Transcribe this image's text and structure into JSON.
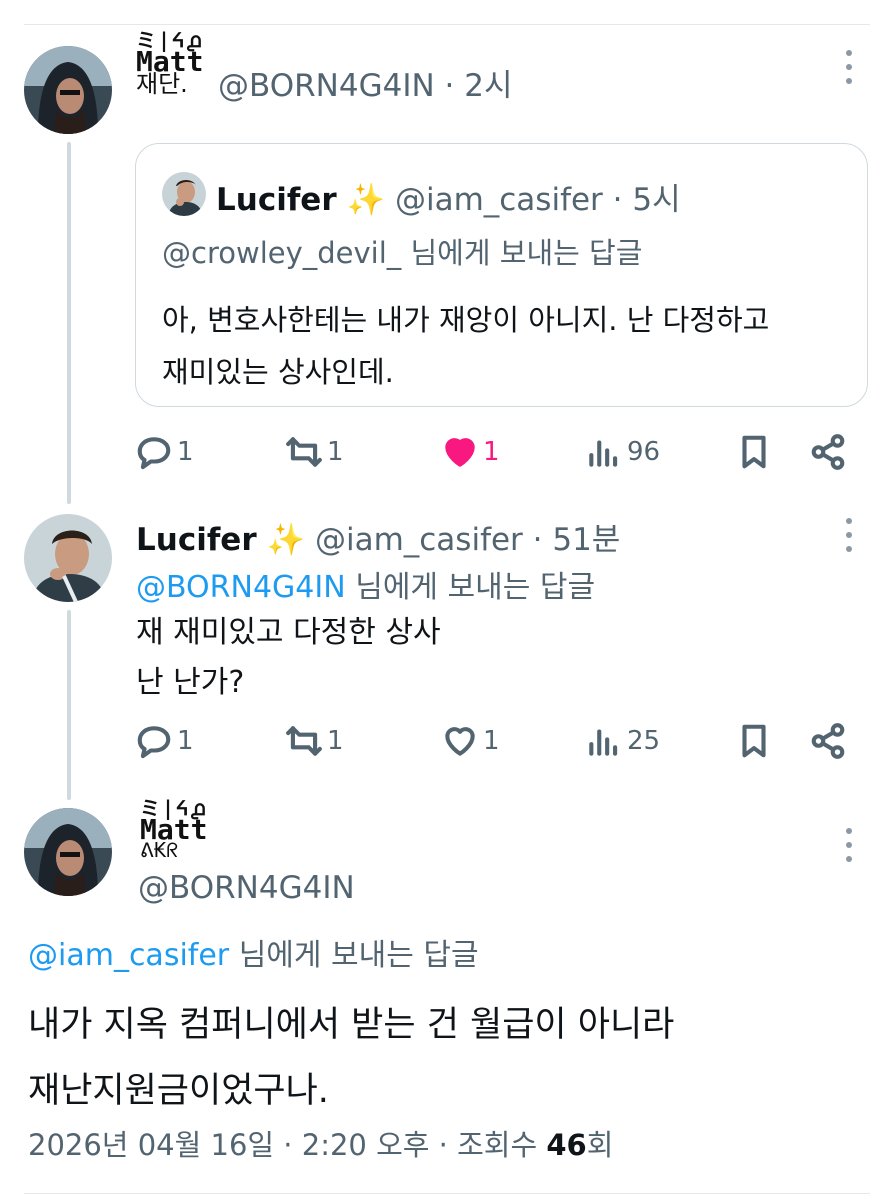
{
  "tweet1": {
    "name_logo_top": "ミ|ᔦ൧",
    "name_logo_mid": "Matt",
    "name_logo_bot": "재단.",
    "handle": "@BORN4G4IN",
    "time": "2시",
    "quote": {
      "name": "Lucifer",
      "emoji": "✨",
      "handle": "@iam_casifer",
      "time": "5시",
      "reply_to": "@crowley_devil_",
      "reply_suffix": "님에게 보내는 답글",
      "text_line1": "아, 변호사한테는 내가 재앙이 아니지. 난 다정하고",
      "text_line2": "재미있는 상사인데."
    },
    "actions": {
      "replies": "1",
      "retweets": "1",
      "likes": "1",
      "views": "96"
    }
  },
  "tweet2": {
    "name": "Lucifer",
    "emoji": "✨",
    "handle": "@iam_casifer",
    "time": "51분",
    "reply_to": "@BORN4G4IN",
    "reply_suffix": "님에게 보내는 답글",
    "text_line1": "재 재미있고 다정한 상사",
    "text_line2": "난 난가?",
    "actions": {
      "replies": "1",
      "retweets": "1",
      "likes": "1",
      "views": "25"
    }
  },
  "tweet3": {
    "name_logo_top": "ミ|ᔦ൧",
    "name_logo_mid": "Matt",
    "name_logo_bot": "ᕕ₭ᖇ",
    "handle": "@BORN4G4IN",
    "reply_to": "@iam_casifer",
    "reply_suffix": "님에게 보내는 답글",
    "text_line1": "내가 지옥 컴퍼니에서 받는 건 월급이 아니라",
    "text_line2": "재난지원금이었구나.",
    "timestamp": "2026년 04월 16일 · 2:20 오후 · 조회수 ",
    "view_count": "46",
    "view_suffix": "회"
  },
  "colors": {
    "link": "#1d9bf0",
    "muted": "#536471",
    "like": "#f91880",
    "line": "#cfd9de"
  }
}
